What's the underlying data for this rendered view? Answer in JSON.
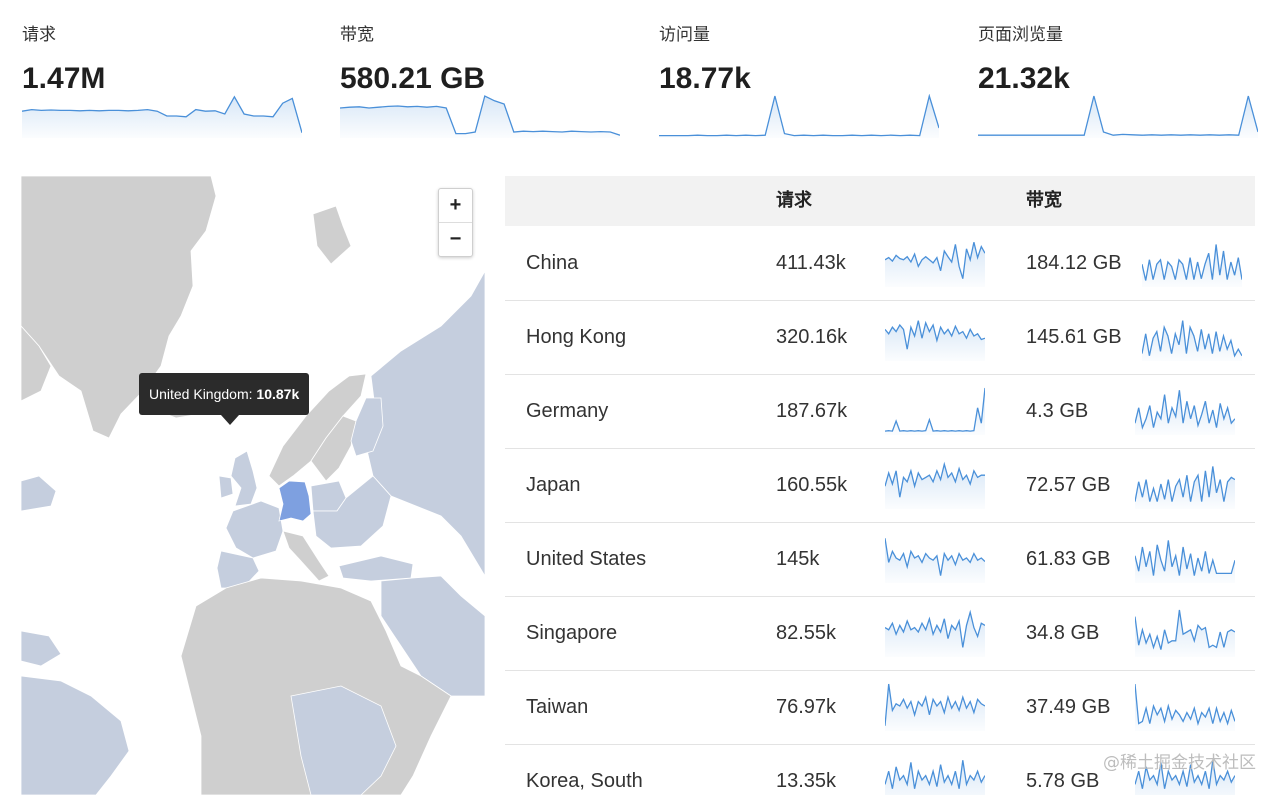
{
  "stats": [
    {
      "label": "请求",
      "value": "1.47M",
      "trend": [
        0.62,
        0.66,
        0.64,
        0.65,
        0.64,
        0.64,
        0.63,
        0.64,
        0.63,
        0.64,
        0.64,
        0.63,
        0.64,
        0.66,
        0.62,
        0.5,
        0.5,
        0.48,
        0.66,
        0.62,
        0.63,
        0.55,
        0.98,
        0.55,
        0.5,
        0.5,
        0.48,
        0.82,
        0.94,
        0.08
      ]
    },
    {
      "label": "带宽",
      "value": "580.21 GB",
      "trend": [
        0.7,
        0.72,
        0.73,
        0.7,
        0.72,
        0.74,
        0.75,
        0.73,
        0.74,
        0.72,
        0.74,
        0.7,
        0.06,
        0.06,
        0.1,
        1.0,
        0.88,
        0.8,
        0.1,
        0.12,
        0.11,
        0.12,
        0.11,
        0.1,
        0.12,
        0.11,
        0.1,
        0.11,
        0.1,
        0.02
      ]
    },
    {
      "label": "访问量",
      "value": "18.77k",
      "trend": [
        0.01,
        0.01,
        0.01,
        0.01,
        0.02,
        0.01,
        0.01,
        0.02,
        0.01,
        0.02,
        0.01,
        0.02,
        1.0,
        0.06,
        0.01,
        0.02,
        0.01,
        0.02,
        0.01,
        0.01,
        0.02,
        0.01,
        0.02,
        0.01,
        0.02,
        0.01,
        0.02,
        0.01,
        1.0,
        0.2
      ]
    },
    {
      "label": "页面浏览量",
      "value": "21.32k",
      "trend": [
        0.02,
        0.02,
        0.02,
        0.02,
        0.02,
        0.02,
        0.02,
        0.02,
        0.02,
        0.02,
        0.02,
        0.02,
        1.0,
        0.1,
        0.02,
        0.04,
        0.03,
        0.02,
        0.03,
        0.02,
        0.03,
        0.02,
        0.03,
        0.02,
        0.03,
        0.02,
        0.03,
        0.02,
        1.0,
        0.1
      ]
    }
  ],
  "map": {
    "zoom_in": "+",
    "zoom_out": "−",
    "tooltip_country": "United Kingdom:",
    "tooltip_value": "10.87k",
    "colors": {
      "land": "#cfcfcf",
      "data": "#c5cede",
      "highlight": "#7ea0e0"
    }
  },
  "table": {
    "headers": [
      "",
      "请求",
      "带宽"
    ],
    "rows": [
      {
        "country": "China",
        "requests": "411.43k",
        "bandwidth": "184.12 GB",
        "req_trend": [
          0.55,
          0.6,
          0.52,
          0.65,
          0.58,
          0.55,
          0.62,
          0.5,
          0.68,
          0.4,
          0.55,
          0.62,
          0.55,
          0.48,
          0.6,
          0.3,
          0.75,
          0.62,
          0.5,
          0.9,
          0.4,
          0.12,
          0.8,
          0.55,
          0.95,
          0.6,
          0.85,
          0.7
        ],
        "bw_trend": [
          0.45,
          0.08,
          0.55,
          0.1,
          0.45,
          0.55,
          0.1,
          0.5,
          0.4,
          0.1,
          0.55,
          0.45,
          0.1,
          0.6,
          0.1,
          0.5,
          0.12,
          0.45,
          0.7,
          0.1,
          0.9,
          0.2,
          0.75,
          0.1,
          0.5,
          0.2,
          0.6,
          0.1
        ]
      },
      {
        "country": "Hong Kong",
        "requests": "320.16k",
        "bandwidth": "145.61 GB",
        "req_trend": [
          0.65,
          0.55,
          0.7,
          0.6,
          0.75,
          0.65,
          0.2,
          0.7,
          0.5,
          0.85,
          0.45,
          0.8,
          0.6,
          0.75,
          0.4,
          0.7,
          0.55,
          0.65,
          0.5,
          0.72,
          0.55,
          0.6,
          0.45,
          0.65,
          0.5,
          0.55,
          0.42,
          0.45
        ],
        "bw_trend": [
          0.1,
          0.55,
          0.05,
          0.45,
          0.6,
          0.15,
          0.7,
          0.5,
          0.1,
          0.55,
          0.3,
          0.85,
          0.1,
          0.7,
          0.5,
          0.15,
          0.65,
          0.2,
          0.55,
          0.1,
          0.6,
          0.15,
          0.5,
          0.2,
          0.4,
          0.05,
          0.2,
          0.05
        ]
      },
      {
        "country": "Germany",
        "requests": "187.67k",
        "bandwidth": "4.3 GB",
        "req_trend": [
          0.02,
          0.03,
          0.02,
          0.25,
          0.02,
          0.03,
          0.02,
          0.03,
          0.02,
          0.03,
          0.02,
          0.03,
          0.28,
          0.02,
          0.03,
          0.02,
          0.03,
          0.02,
          0.03,
          0.02,
          0.03,
          0.02,
          0.03,
          0.02,
          0.03,
          0.55,
          0.2,
          1.0
        ],
        "bw_trend": [
          0.2,
          0.55,
          0.1,
          0.3,
          0.6,
          0.1,
          0.45,
          0.3,
          0.85,
          0.2,
          0.55,
          0.35,
          0.95,
          0.2,
          0.7,
          0.3,
          0.6,
          0.15,
          0.4,
          0.7,
          0.2,
          0.5,
          0.1,
          0.65,
          0.3,
          0.55,
          0.2,
          0.3
        ]
      },
      {
        "country": "Japan",
        "requests": "160.55k",
        "bandwidth": "72.57 GB",
        "req_trend": [
          0.45,
          0.75,
          0.5,
          0.8,
          0.2,
          0.65,
          0.55,
          0.8,
          0.45,
          0.75,
          0.6,
          0.65,
          0.7,
          0.55,
          0.8,
          0.6,
          0.95,
          0.65,
          0.75,
          0.55,
          0.85,
          0.6,
          0.7,
          0.5,
          0.8,
          0.65,
          0.7,
          0.7
        ],
        "bw_trend": [
          0.1,
          0.55,
          0.2,
          0.6,
          0.1,
          0.4,
          0.1,
          0.5,
          0.15,
          0.6,
          0.1,
          0.45,
          0.6,
          0.2,
          0.7,
          0.1,
          0.55,
          0.7,
          0.1,
          0.8,
          0.2,
          0.9,
          0.3,
          0.6,
          0.1,
          0.55,
          0.65,
          0.6
        ]
      },
      {
        "country": "United States",
        "requests": "145k",
        "bandwidth": "61.83 GB",
        "req_trend": [
          0.95,
          0.4,
          0.65,
          0.5,
          0.45,
          0.6,
          0.3,
          0.65,
          0.5,
          0.55,
          0.4,
          0.6,
          0.5,
          0.45,
          0.55,
          0.1,
          0.6,
          0.45,
          0.55,
          0.35,
          0.6,
          0.45,
          0.5,
          0.4,
          0.6,
          0.45,
          0.5,
          0.42
        ],
        "bw_trend": [
          0.55,
          0.2,
          0.75,
          0.3,
          0.65,
          0.1,
          0.8,
          0.45,
          0.2,
          0.9,
          0.3,
          0.55,
          0.1,
          0.75,
          0.25,
          0.6,
          0.1,
          0.5,
          0.2,
          0.65,
          0.15,
          0.45,
          0.15,
          0.15,
          0.15,
          0.15,
          0.15,
          0.45
        ]
      },
      {
        "country": "Singapore",
        "requests": "82.55k",
        "bandwidth": "34.8 GB",
        "req_trend": [
          0.6,
          0.55,
          0.7,
          0.45,
          0.65,
          0.5,
          0.75,
          0.55,
          0.6,
          0.5,
          0.7,
          0.55,
          0.8,
          0.45,
          0.65,
          0.5,
          0.8,
          0.35,
          0.65,
          0.55,
          0.75,
          0.15,
          0.65,
          0.95,
          0.6,
          0.4,
          0.7,
          0.65
        ],
        "bw_trend": [
          0.85,
          0.2,
          0.55,
          0.25,
          0.45,
          0.15,
          0.4,
          0.1,
          0.55,
          0.25,
          0.3,
          0.3,
          1.0,
          0.45,
          0.5,
          0.55,
          0.3,
          0.65,
          0.55,
          0.6,
          0.15,
          0.2,
          0.15,
          0.5,
          0.15,
          0.5,
          0.55,
          0.5
        ]
      },
      {
        "country": "Taiwan",
        "requests": "76.97k",
        "bandwidth": "37.49 GB",
        "req_trend": [
          0.05,
          1.0,
          0.4,
          0.55,
          0.5,
          0.65,
          0.45,
          0.6,
          0.3,
          0.6,
          0.5,
          0.7,
          0.3,
          0.65,
          0.5,
          0.6,
          0.35,
          0.7,
          0.45,
          0.6,
          0.4,
          0.7,
          0.45,
          0.6,
          0.35,
          0.65,
          0.55,
          0.5
        ],
        "bw_trend": [
          1.0,
          0.1,
          0.15,
          0.45,
          0.1,
          0.5,
          0.3,
          0.45,
          0.15,
          0.5,
          0.2,
          0.4,
          0.3,
          0.15,
          0.35,
          0.2,
          0.45,
          0.1,
          0.35,
          0.25,
          0.45,
          0.1,
          0.45,
          0.15,
          0.35,
          0.1,
          0.4,
          0.15
        ]
      },
      {
        "country": "Korea, South",
        "requests": "13.35k",
        "bandwidth": "5.78 GB",
        "req_trend": [
          0.4,
          0.7,
          0.3,
          0.8,
          0.5,
          0.6,
          0.4,
          0.9,
          0.3,
          0.7,
          0.5,
          0.6,
          0.4,
          0.7,
          0.35,
          0.85,
          0.45,
          0.6,
          0.4,
          0.7,
          0.3,
          0.95,
          0.4,
          0.6,
          0.5,
          0.7,
          0.45,
          0.6
        ],
        "bw_trend": [
          0.4,
          0.7,
          0.3,
          0.8,
          0.5,
          0.6,
          0.4,
          0.9,
          0.3,
          0.7,
          0.5,
          0.6,
          0.4,
          0.7,
          0.35,
          0.85,
          0.45,
          0.6,
          0.4,
          0.7,
          0.3,
          0.95,
          0.4,
          0.6,
          0.5,
          0.7,
          0.45,
          0.6
        ]
      }
    ]
  },
  "watermark": "@稀土掘金技术社区"
}
